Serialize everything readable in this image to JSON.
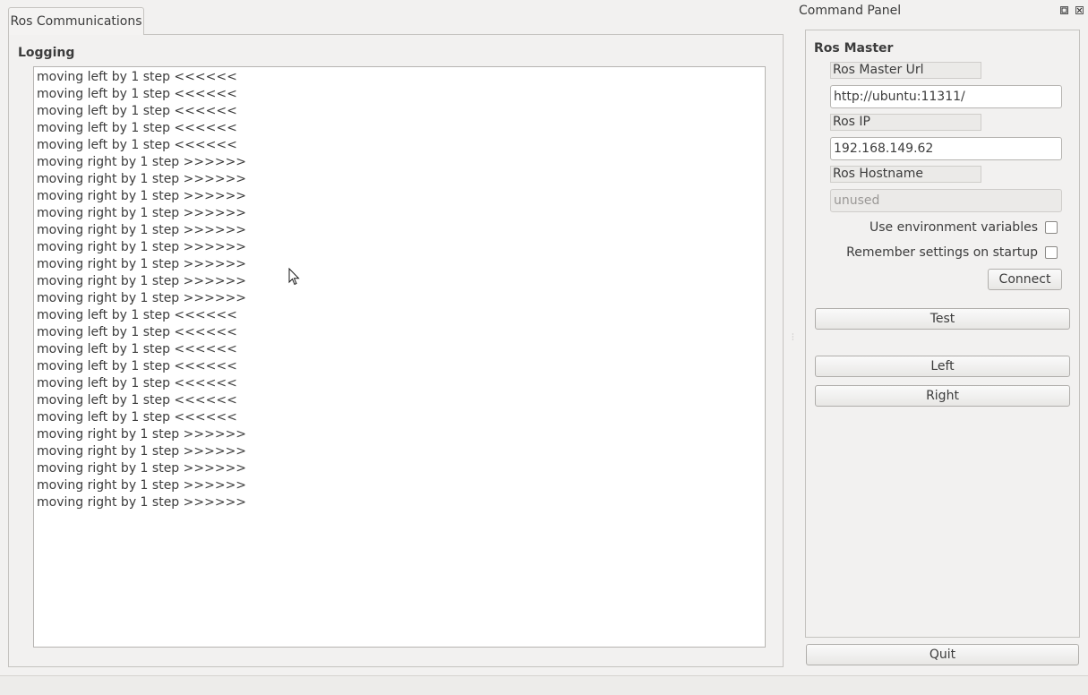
{
  "tabs": [
    {
      "label": "Ros Communications"
    }
  ],
  "logging": {
    "title": "Logging",
    "lines": [
      "moving left by 1 step <<<<<<",
      "moving left by 1 step <<<<<<",
      "moving left by 1 step <<<<<<",
      "moving left by 1 step <<<<<<",
      "moving left by 1 step <<<<<<",
      "moving right by 1 step >>>>>>",
      "moving right by 1 step >>>>>>",
      "moving right by 1 step >>>>>>",
      "moving right by 1 step >>>>>>",
      "moving right by 1 step >>>>>>",
      "moving right by 1 step >>>>>>",
      "moving right by 1 step >>>>>>",
      "moving right by 1 step >>>>>>",
      "moving right by 1 step >>>>>>",
      "moving left by 1 step <<<<<<",
      "moving left by 1 step <<<<<<",
      "moving left by 1 step <<<<<<",
      "moving left by 1 step <<<<<<",
      "moving left by 1 step <<<<<<",
      "moving left by 1 step <<<<<<",
      "moving left by 1 step <<<<<<",
      "moving right by 1 step >>>>>>",
      "moving right by 1 step >>>>>>",
      "moving right by 1 step >>>>>>",
      "moving right by 1 step >>>>>>",
      "moving right by 1 step >>>>>>"
    ]
  },
  "command_panel": {
    "title": "Command Panel",
    "icons": {
      "float": "float-icon",
      "close": "close-icon"
    },
    "ros_master": {
      "title": "Ros Master",
      "master_url_label": "Ros Master Url",
      "master_url_value": "http://ubuntu:11311/",
      "ros_ip_label": "Ros IP",
      "ros_ip_value": "192.168.149.62",
      "hostname_label": "Ros Hostname",
      "hostname_value": "unused",
      "env_vars_label": "Use environment variables",
      "remember_label": "Remember settings on startup",
      "connect_label": "Connect"
    },
    "test_label": "Test",
    "left_label": "Left",
    "right_label": "Right",
    "quit_label": "Quit"
  }
}
